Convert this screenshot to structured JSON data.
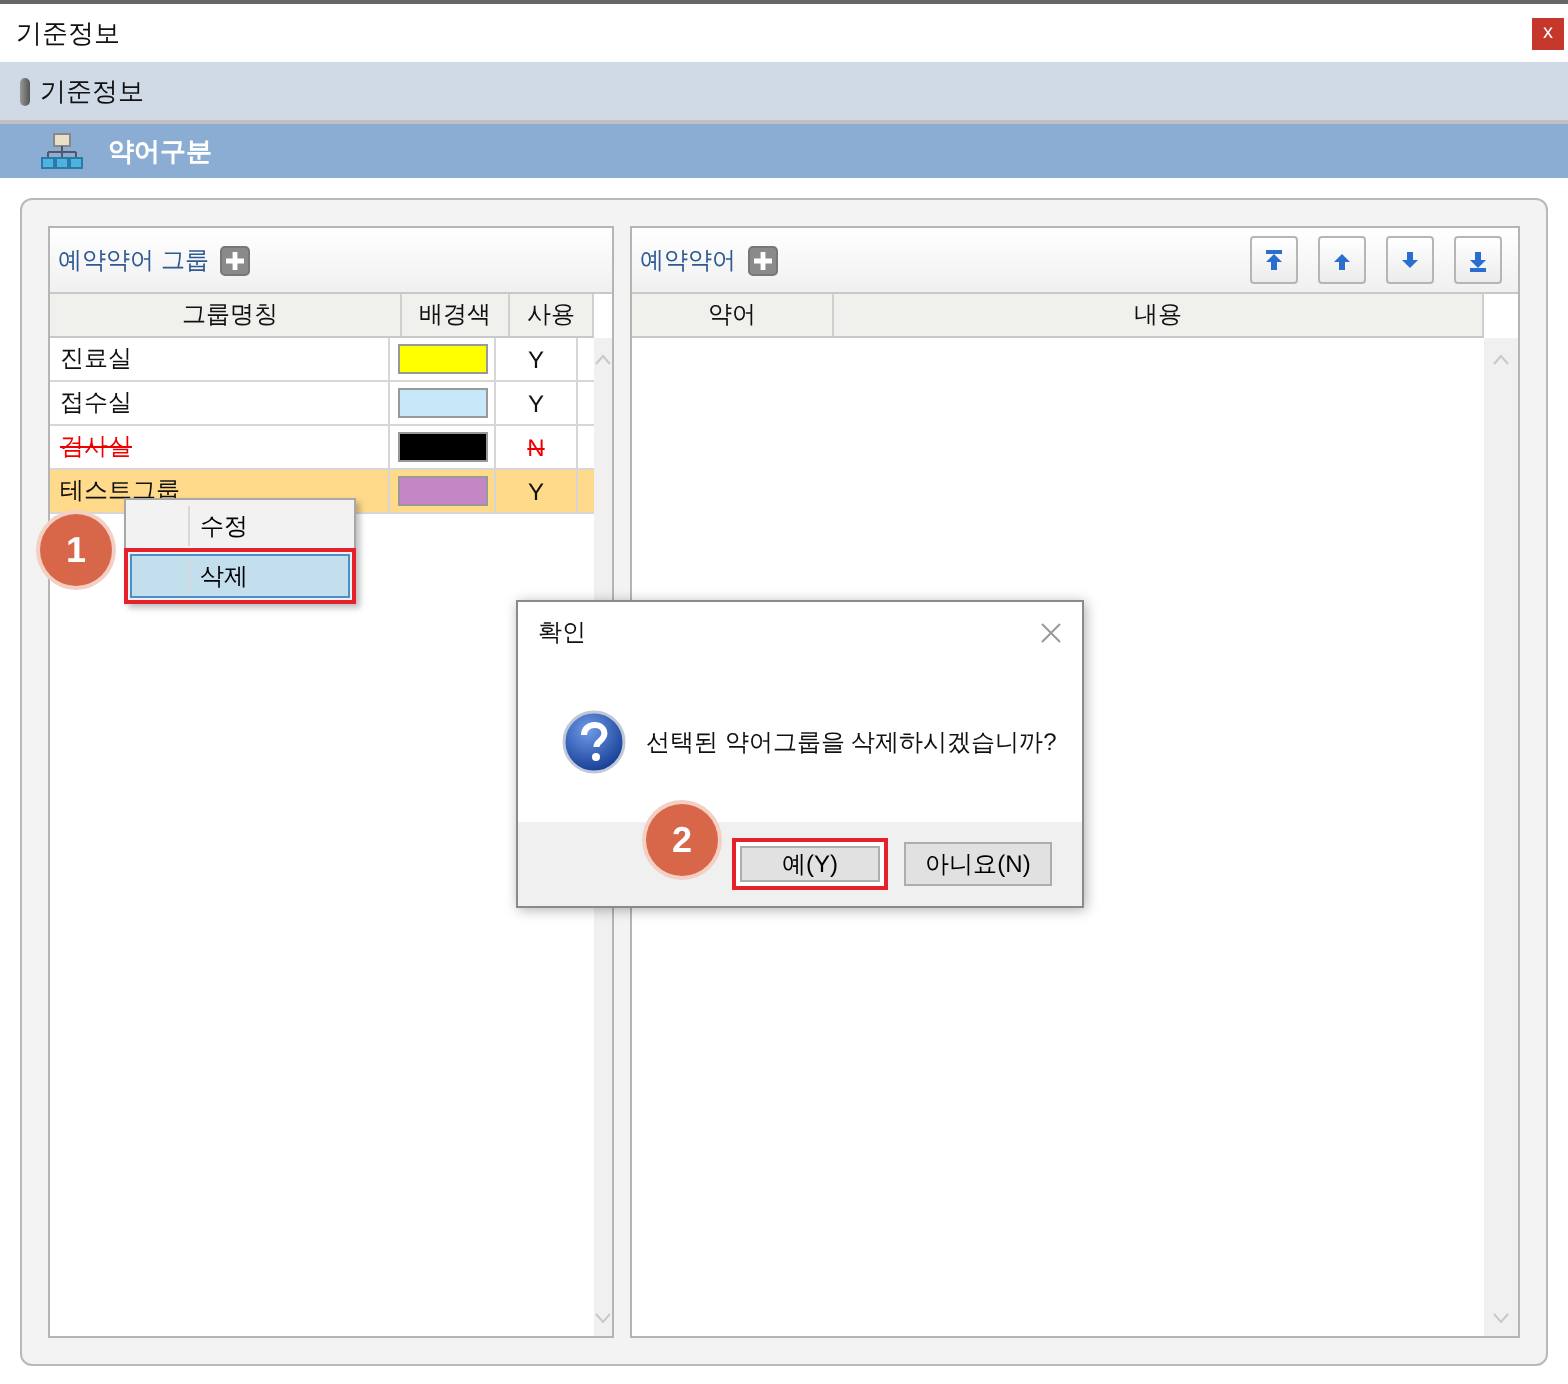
{
  "window": {
    "title": "기준정보",
    "close": "x"
  },
  "breadcrumb": "기준정보",
  "section": "약어구분",
  "group_panel": {
    "title": "예약약어 그룹",
    "columns": [
      "그룹명칭",
      "배경색",
      "사용"
    ],
    "rows": [
      {
        "name": "진료실",
        "color": "#ffff00",
        "use": "Y",
        "deleted": false,
        "selected": false
      },
      {
        "name": "접수실",
        "color": "#c6e8f8",
        "use": "Y",
        "deleted": false,
        "selected": false
      },
      {
        "name": "검사실",
        "color": "#000000",
        "use": "N",
        "deleted": true,
        "selected": false
      },
      {
        "name": "테스트그룹",
        "color": "#c586c6",
        "use": "Y",
        "deleted": false,
        "selected": true
      }
    ]
  },
  "abbrev_panel": {
    "title": "예약약어",
    "columns": [
      "약어",
      "내용"
    ]
  },
  "context_menu": {
    "callout": "1",
    "items": [
      {
        "label": "수정",
        "selected": false
      },
      {
        "label": "삭제",
        "selected": true
      }
    ]
  },
  "dialog": {
    "title": "확인",
    "message": "선택된 약어그룹을 삭제하시겠습니까?",
    "callout": "2",
    "buttons": [
      {
        "label": "예(Y)",
        "selected": true
      },
      {
        "label": "아니요(N)",
        "selected": false
      }
    ]
  }
}
